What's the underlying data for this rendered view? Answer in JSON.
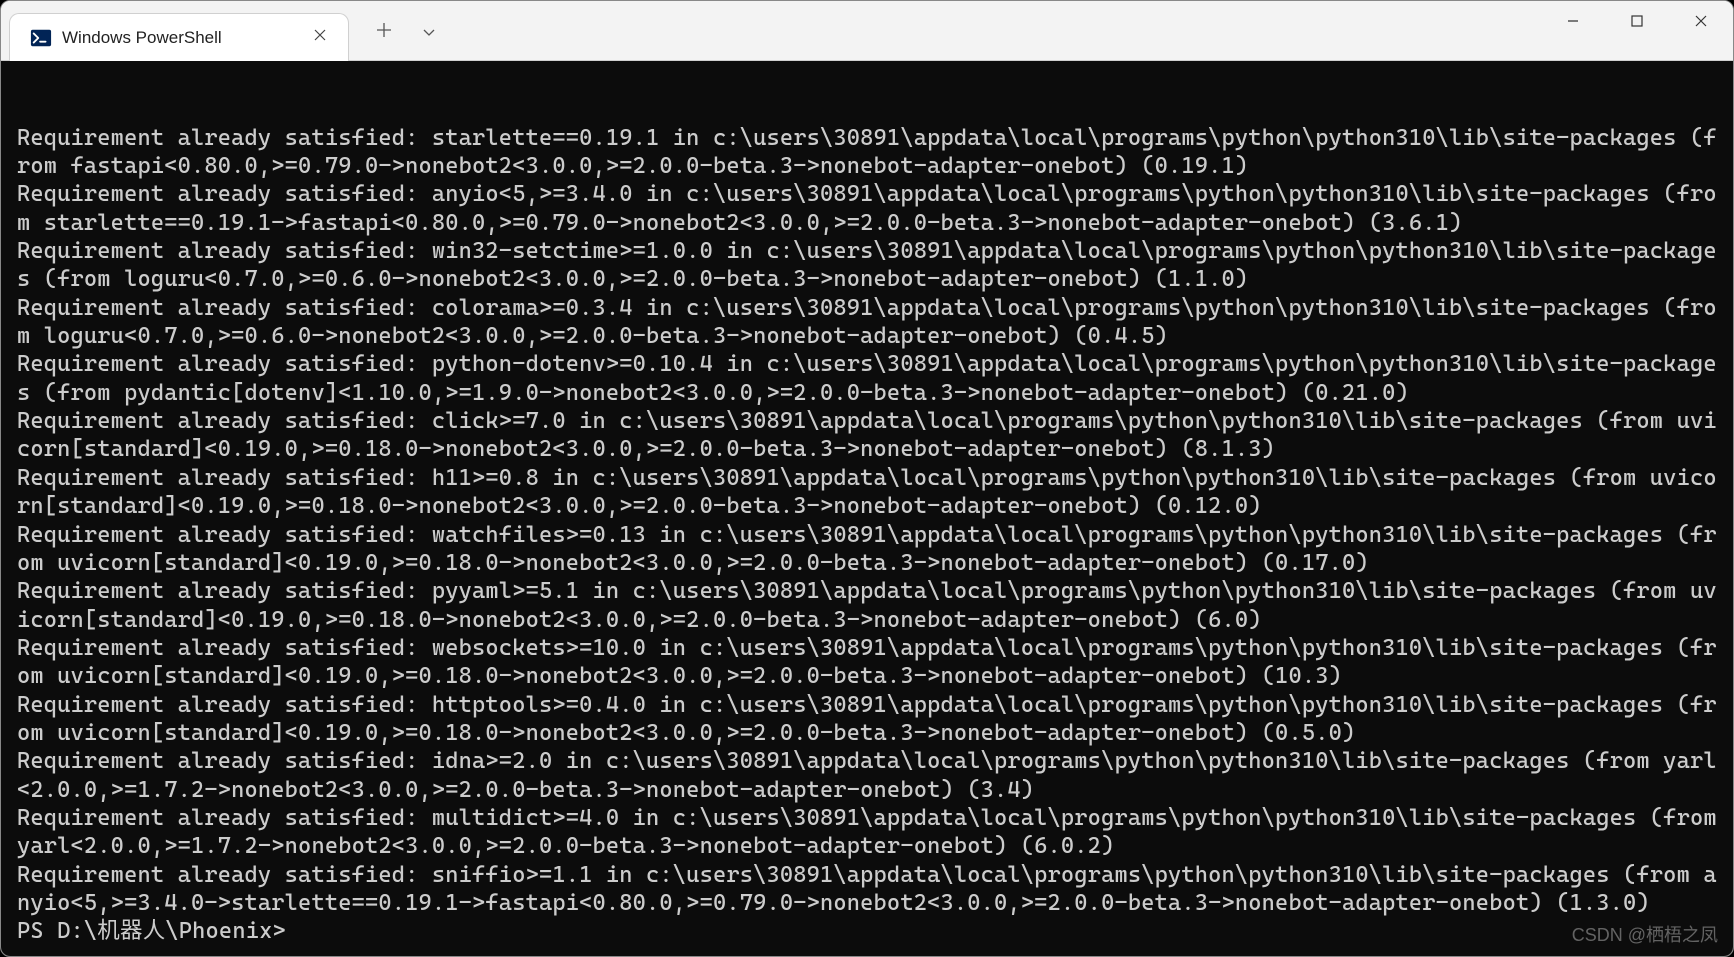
{
  "tab": {
    "title": "Windows PowerShell"
  },
  "terminal": {
    "lines": [
      "Requirement already satisfied: starlette==0.19.1 in c:\\users\\30891\\appdata\\local\\programs\\python\\python310\\lib\\site-packages (from fastapi<0.80.0,>=0.79.0->nonebot2<3.0.0,>=2.0.0-beta.3->nonebot-adapter-onebot) (0.19.1)",
      "Requirement already satisfied: anyio<5,>=3.4.0 in c:\\users\\30891\\appdata\\local\\programs\\python\\python310\\lib\\site-packages (from starlette==0.19.1->fastapi<0.80.0,>=0.79.0->nonebot2<3.0.0,>=2.0.0-beta.3->nonebot-adapter-onebot) (3.6.1)",
      "Requirement already satisfied: win32-setctime>=1.0.0 in c:\\users\\30891\\appdata\\local\\programs\\python\\python310\\lib\\site-packages (from loguru<0.7.0,>=0.6.0->nonebot2<3.0.0,>=2.0.0-beta.3->nonebot-adapter-onebot) (1.1.0)",
      "Requirement already satisfied: colorama>=0.3.4 in c:\\users\\30891\\appdata\\local\\programs\\python\\python310\\lib\\site-packages (from loguru<0.7.0,>=0.6.0->nonebot2<3.0.0,>=2.0.0-beta.3->nonebot-adapter-onebot) (0.4.5)",
      "Requirement already satisfied: python-dotenv>=0.10.4 in c:\\users\\30891\\appdata\\local\\programs\\python\\python310\\lib\\site-packages (from pydantic[dotenv]<1.10.0,>=1.9.0->nonebot2<3.0.0,>=2.0.0-beta.3->nonebot-adapter-onebot) (0.21.0)",
      "Requirement already satisfied: click>=7.0 in c:\\users\\30891\\appdata\\local\\programs\\python\\python310\\lib\\site-packages (from uvicorn[standard]<0.19.0,>=0.18.0->nonebot2<3.0.0,>=2.0.0-beta.3->nonebot-adapter-onebot) (8.1.3)",
      "Requirement already satisfied: h11>=0.8 in c:\\users\\30891\\appdata\\local\\programs\\python\\python310\\lib\\site-packages (from uvicorn[standard]<0.19.0,>=0.18.0->nonebot2<3.0.0,>=2.0.0-beta.3->nonebot-adapter-onebot) (0.12.0)",
      "Requirement already satisfied: watchfiles>=0.13 in c:\\users\\30891\\appdata\\local\\programs\\python\\python310\\lib\\site-packages (from uvicorn[standard]<0.19.0,>=0.18.0->nonebot2<3.0.0,>=2.0.0-beta.3->nonebot-adapter-onebot) (0.17.0)",
      "Requirement already satisfied: pyyaml>=5.1 in c:\\users\\30891\\appdata\\local\\programs\\python\\python310\\lib\\site-packages (from uvicorn[standard]<0.19.0,>=0.18.0->nonebot2<3.0.0,>=2.0.0-beta.3->nonebot-adapter-onebot) (6.0)",
      "Requirement already satisfied: websockets>=10.0 in c:\\users\\30891\\appdata\\local\\programs\\python\\python310\\lib\\site-packages (from uvicorn[standard]<0.19.0,>=0.18.0->nonebot2<3.0.0,>=2.0.0-beta.3->nonebot-adapter-onebot) (10.3)",
      "Requirement already satisfied: httptools>=0.4.0 in c:\\users\\30891\\appdata\\local\\programs\\python\\python310\\lib\\site-packages (from uvicorn[standard]<0.19.0,>=0.18.0->nonebot2<3.0.0,>=2.0.0-beta.3->nonebot-adapter-onebot) (0.5.0)",
      "Requirement already satisfied: idna>=2.0 in c:\\users\\30891\\appdata\\local\\programs\\python\\python310\\lib\\site-packages (from yarl<2.0.0,>=1.7.2->nonebot2<3.0.0,>=2.0.0-beta.3->nonebot-adapter-onebot) (3.4)",
      "Requirement already satisfied: multidict>=4.0 in c:\\users\\30891\\appdata\\local\\programs\\python\\python310\\lib\\site-packages (from yarl<2.0.0,>=1.7.2->nonebot2<3.0.0,>=2.0.0-beta.3->nonebot-adapter-onebot) (6.0.2)",
      "Requirement already satisfied: sniffio>=1.1 in c:\\users\\30891\\appdata\\local\\programs\\python\\python310\\lib\\site-packages (from anyio<5,>=3.4.0->starlette==0.19.1->fastapi<0.80.0,>=0.79.0->nonebot2<3.0.0,>=2.0.0-beta.3->nonebot-adapter-onebot) (1.3.0)"
    ],
    "prompt": "PS D:\\机器人\\Phoenix>"
  },
  "watermark": "CSDN @栖梧之凤"
}
